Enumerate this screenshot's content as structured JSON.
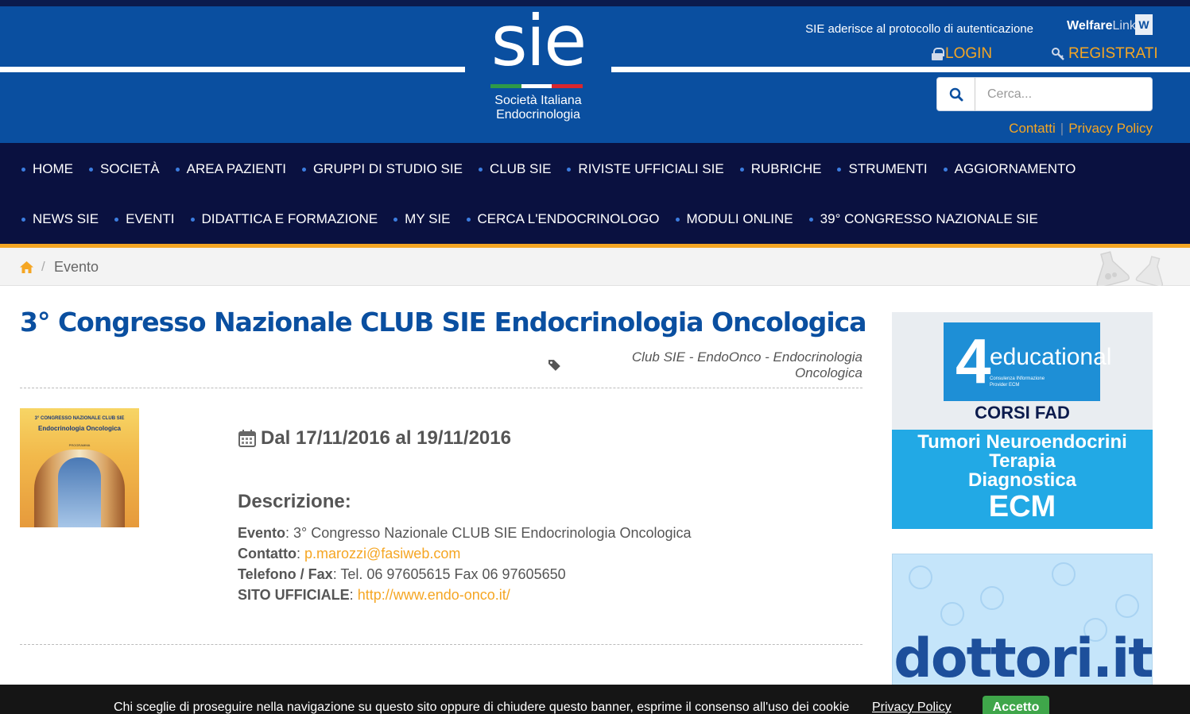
{
  "header": {
    "logo_text": "sie",
    "logo_sub_line1": "Società Italiana",
    "logo_sub_line2": "Endocrinologia",
    "auth_text": "SIE aderisce al protocollo di autenticazione",
    "welfare_brand_a": "Welfare",
    "welfare_brand_b": "Link",
    "welfare_mark": "W",
    "login_label": "LOGIN",
    "register_label": "REGISTRATI",
    "search_placeholder": "Cerca...",
    "contatti_label": "Contatti",
    "link_separator": "|",
    "privacy_label": "Privacy Policy",
    "flag_colors": [
      "#2e9a48",
      "#ffffff",
      "#d9262e"
    ]
  },
  "nav": {
    "row1": [
      "HOME",
      "SOCIETÀ",
      "AREA PAZIENTI",
      "GRUPPI DI STUDIO SIE",
      "CLUB SIE",
      "RIVISTE UFFICIALI SIE",
      "RUBRICHE",
      "STRUMENTI",
      "AGGIORNAMENTO"
    ],
    "row2": [
      "NEWS SIE",
      "EVENTI",
      "DIDATTICA E FORMAZIONE",
      "MY SIE",
      "CERCA L'ENDOCRINOLOGO",
      "MODULI ONLINE",
      "39° CONGRESSO NAZIONALE SIE"
    ]
  },
  "breadcrumb": {
    "separator": "/",
    "current": "Evento"
  },
  "event": {
    "title": "3° Congresso Nazionale CLUB SIE Endocrinologia Oncologica",
    "tag": "Club SIE - EndoOnco - Endocrinologia Oncologica",
    "date": "Dal 17/11/2016 al 19/11/2016",
    "description_heading": "Descrizione:",
    "poster_line1": "3° CONGRESSO NAZIONALE CLUB SIE",
    "poster_line2": "Endocrinologia Oncologica",
    "poster_line3": "PROGRAMMA",
    "fields": {
      "evento_label": "Evento",
      "evento_value": "3° Congresso Nazionale CLUB SIE Endocrinologia Oncologica",
      "contatto_label": "Contatto",
      "contatto_value": "p.marozzi@fasiweb.com",
      "telefono_label": "Telefono / Fax",
      "telefono_value": "Tel. 06 97605615 Fax 06 97605650",
      "sito_label": "SITO UFFICIALE",
      "sito_value": "http://www.endo-onco.it/"
    }
  },
  "sidebar": {
    "ad1": {
      "number": "4",
      "brand": "educational",
      "sub1": "Consulenza INformazione",
      "sub2": "Provider ECM",
      "corsi": "CORSI FAD",
      "line1": "Tumori Neuroendocrini",
      "line2": "Terapia",
      "line3": "Diagnostica",
      "line4": "ECM"
    },
    "ad2": {
      "text": "dottori.it"
    }
  },
  "cookie": {
    "text": "Chi sceglie di proseguire nella navigazione su questo sito oppure di chiudere questo banner, esprime il consenso all'uso dei cookie",
    "policy_label": "Privacy Policy",
    "accept_label": "Accetto"
  },
  "colors": {
    "header_blue": "#0a4fa0",
    "nav_dark": "#0a1140",
    "accent_orange": "#f5a623",
    "title_blue": "#0a4fa0",
    "accept_green": "#3fa64a"
  }
}
